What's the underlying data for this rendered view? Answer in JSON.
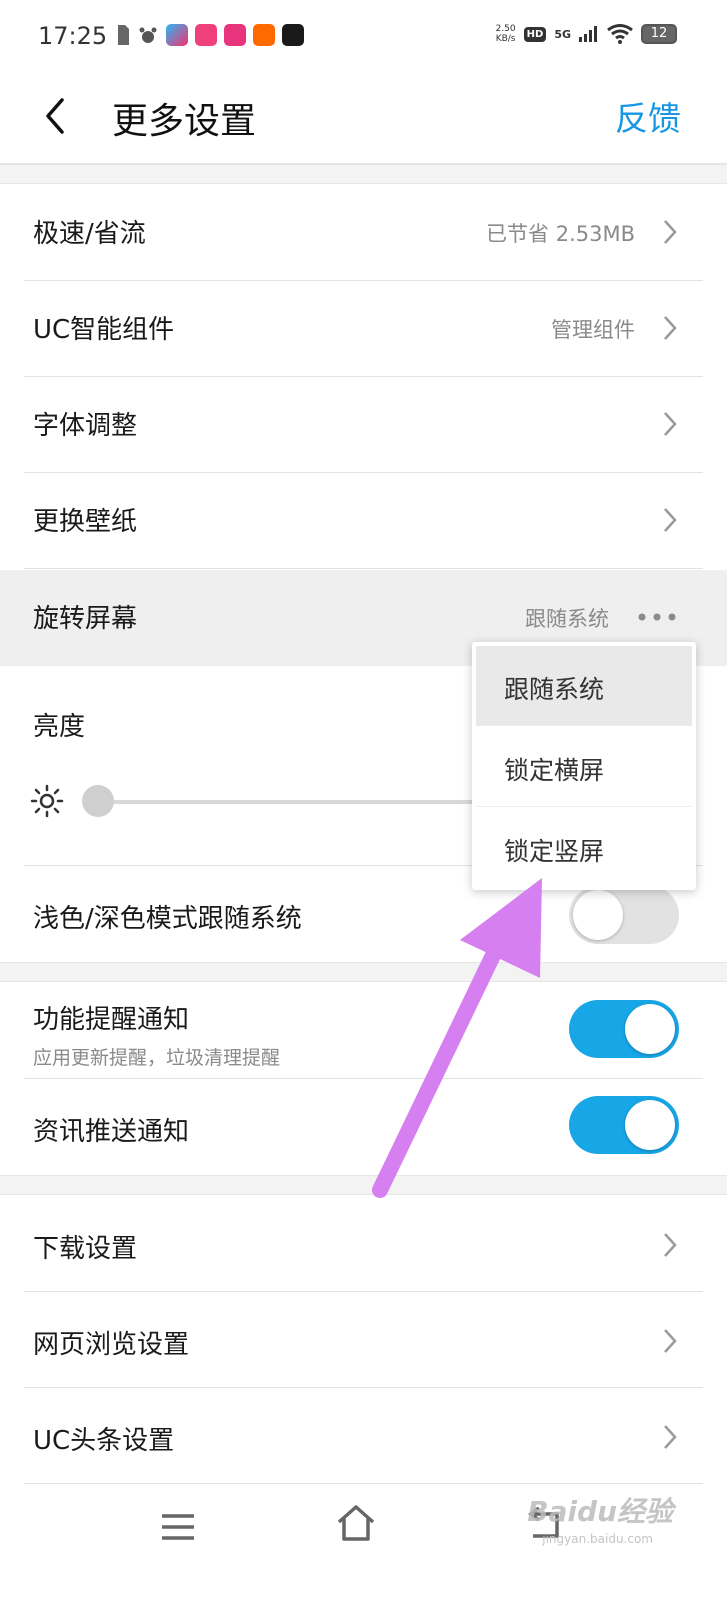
{
  "status_bar": {
    "time": "17:25",
    "net_speed_value": "2.50",
    "net_speed_unit": "KB/s",
    "hd": "HD",
    "network": "5G",
    "battery": "12"
  },
  "header": {
    "title": "更多设置",
    "feedback": "反馈"
  },
  "settings": {
    "speed_saver": {
      "label": "极速/省流",
      "value": "已节省 2.53MB"
    },
    "uc_widgets": {
      "label": "UC智能组件",
      "value": "管理组件"
    },
    "font_adjust": {
      "label": "字体调整"
    },
    "wallpaper": {
      "label": "更换壁纸"
    },
    "rotate_screen": {
      "label": "旋转屏幕",
      "value": "跟随系统"
    },
    "brightness": {
      "label": "亮度",
      "level": 0
    },
    "dark_mode": {
      "label": "浅色/深色模式跟随系统",
      "enabled": false
    },
    "feature_notify": {
      "label": "功能提醒通知",
      "sublabel": "应用更新提醒，垃圾清理提醒",
      "enabled": true
    },
    "news_push": {
      "label": "资讯推送通知",
      "enabled": true
    },
    "download": {
      "label": "下载设置"
    },
    "web_browse": {
      "label": "网页浏览设置"
    },
    "uc_headline": {
      "label": "UC头条设置"
    }
  },
  "rotate_menu": {
    "options": [
      "跟随系统",
      "锁定横屏",
      "锁定竖屏"
    ],
    "selected": "跟随系统"
  },
  "watermark": {
    "text": "Baidu经验",
    "sub": "jingyan.baidu.com"
  },
  "colors": {
    "accent": "#17a6e6",
    "link": "#1797e3",
    "annotation_arrow": "#d67ff0"
  }
}
